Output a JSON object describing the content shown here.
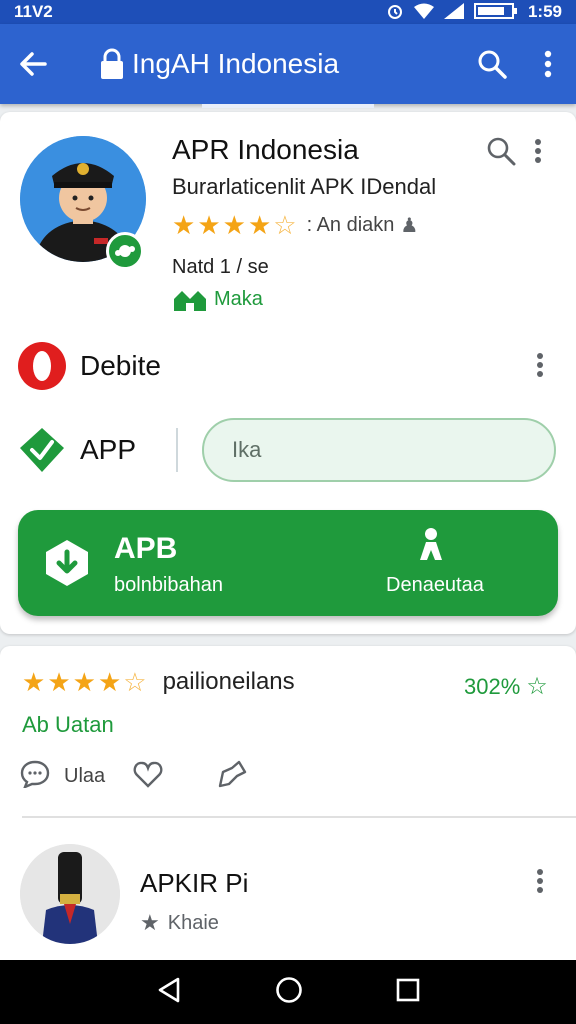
{
  "status_bar": {
    "left_text": "11V2",
    "time": "1:59"
  },
  "app_bar": {
    "title": "IngAH Indonesia",
    "icons": [
      "back-arrow-icon",
      "lock-icon",
      "search-icon",
      "more-vert-icon"
    ]
  },
  "app_card": {
    "name": "APR Indonesia",
    "subtitle": "Burarlaticenlit APK IDendal",
    "rating_stars": 4,
    "rating_text": "An diakn",
    "meta": "Natd 1 / se",
    "maker": "Maka",
    "rows": [
      {
        "label": "Debite",
        "icon": "opera-icon"
      },
      {
        "label": "APP",
        "icon": "check-shield-icon"
      }
    ],
    "input_value": "Ika",
    "primary_button": {
      "title": "APB",
      "subtitle": "bolnbibahan",
      "right_label": "Denaeutaa"
    },
    "colors": {
      "accent_green": "#1f9a3c",
      "app_bar_blue": "#2d63cf",
      "star": "#f4a416",
      "opera_red": "#e01e1e"
    }
  },
  "review_card": {
    "rating_stars": 4,
    "review_text": "pailioneilans",
    "count": "302%",
    "link": "Ab Uatan",
    "action_label": "Ulaa"
  },
  "list_item": {
    "title": "APKIR Pi",
    "subtitle": "Khaie"
  },
  "nav_bar": {
    "icons": [
      "back-triangle-icon",
      "home-circle-icon",
      "recents-square-icon"
    ]
  }
}
